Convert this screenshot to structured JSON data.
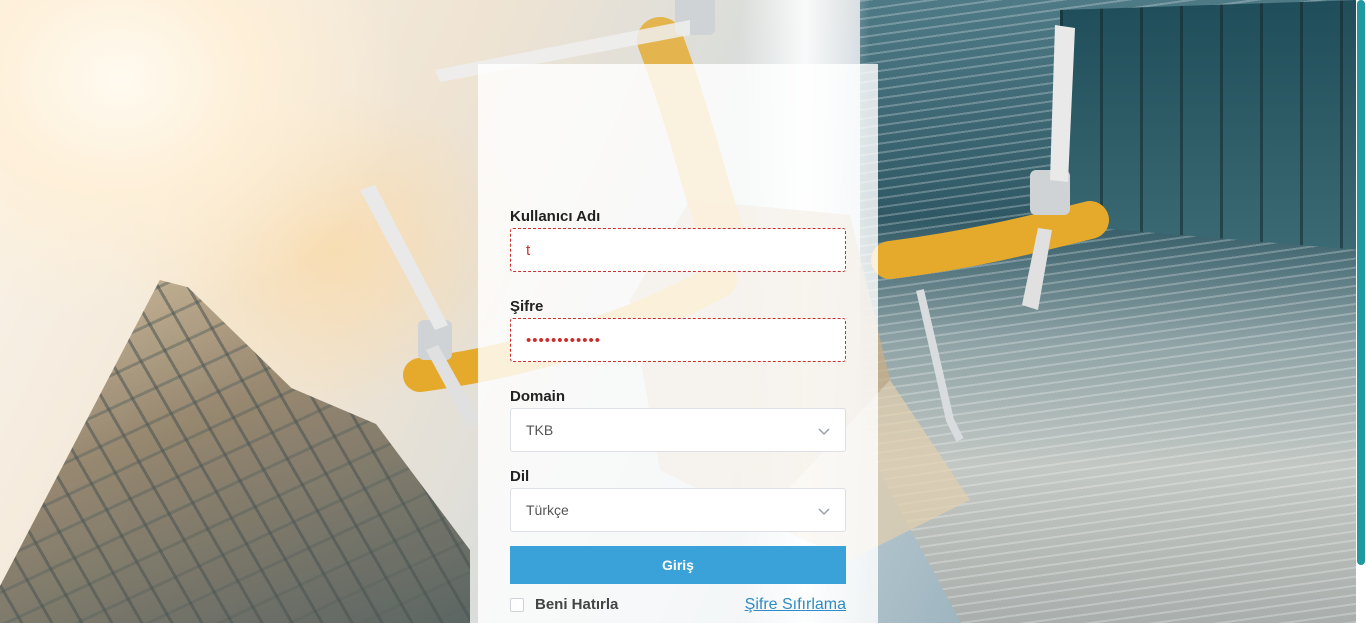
{
  "login": {
    "username_label": "Kullanıcı Adı",
    "username_value": "t",
    "password_label": "Şifre",
    "password_value": "••••••••••••",
    "domain_label": "Domain",
    "domain_selected": "TKB",
    "language_label": "Dil",
    "language_selected": "Türkçe",
    "submit_label": "Giriş",
    "remember_label": "Beni Hatırla",
    "reset_label": "Şifre Sıfırlama"
  },
  "colors": {
    "accent": "#3aa1d9",
    "error": "#c9302c",
    "link": "#2f8ac6",
    "scrollbar": "#1f9aa0"
  },
  "icons": {
    "select_chevron": "chevron-down-icon"
  }
}
